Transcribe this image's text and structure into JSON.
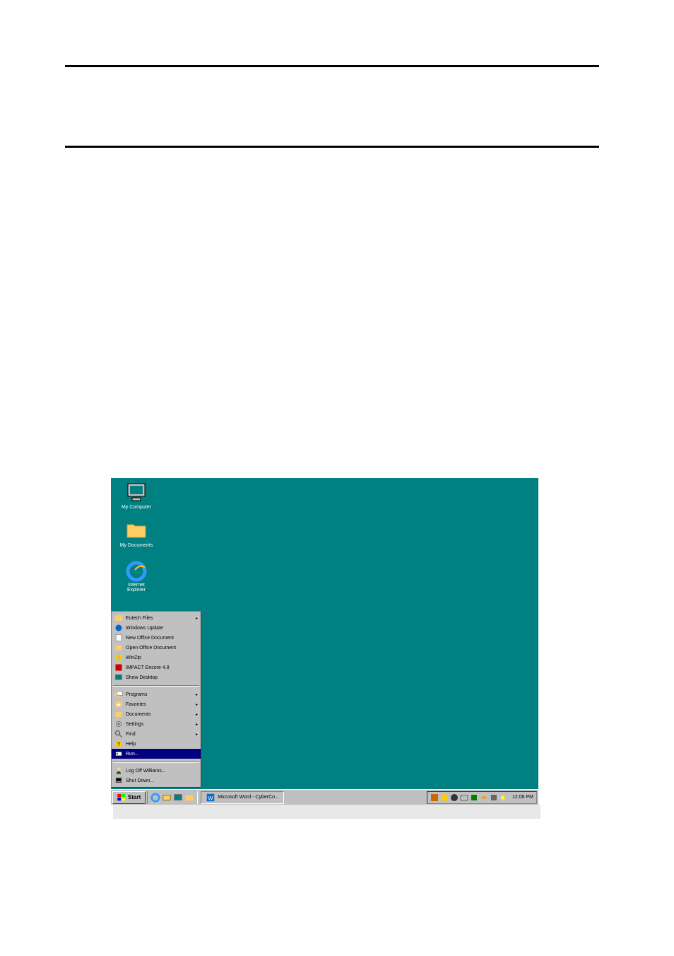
{
  "desktop": {
    "icons": [
      {
        "label": "My Computer"
      },
      {
        "label": "My Documents"
      },
      {
        "label": "Internet Explorer"
      }
    ]
  },
  "start_menu": {
    "top_items": [
      {
        "label": "Eutech Files",
        "has_arrow": true,
        "icon": "folder-icon"
      },
      {
        "label": "Windows Update",
        "has_arrow": false,
        "icon": "update-icon"
      },
      {
        "label": "New Office Document",
        "has_arrow": false,
        "icon": "doc-new-icon"
      },
      {
        "label": "Open Office Document",
        "has_arrow": false,
        "icon": "doc-open-icon"
      },
      {
        "label": "WinZip",
        "has_arrow": false,
        "icon": "winzip-icon"
      },
      {
        "label": "IMPACT Encore 4.8",
        "has_arrow": false,
        "icon": "impact-icon"
      },
      {
        "label": "Show Desktop",
        "has_arrow": false,
        "icon": "desktop-icon"
      }
    ],
    "middle_items": [
      {
        "label": "Programs",
        "has_arrow": true,
        "icon": "programs-icon"
      },
      {
        "label": "Favorites",
        "has_arrow": true,
        "icon": "favorites-icon"
      },
      {
        "label": "Documents",
        "has_arrow": true,
        "icon": "documents-icon"
      },
      {
        "label": "Settings",
        "has_arrow": true,
        "icon": "settings-icon"
      },
      {
        "label": "Find",
        "has_arrow": true,
        "icon": "find-icon"
      },
      {
        "label": "Help",
        "has_arrow": false,
        "icon": "help-icon"
      },
      {
        "label": "Run...",
        "has_arrow": false,
        "icon": "run-icon",
        "highlighted": true
      }
    ],
    "bottom_items": [
      {
        "label": "Log Off Williams...",
        "has_arrow": false,
        "icon": "logoff-icon"
      },
      {
        "label": "Shut Down...",
        "has_arrow": false,
        "icon": "shutdown-icon"
      }
    ]
  },
  "taskbar": {
    "start_label": "Start",
    "task_button": "Microsoft Word - CyberCo...",
    "clock": "12:08 PM"
  },
  "colors": {
    "desktop_bg": "#008080",
    "taskbar_bg": "#c0c0c0",
    "highlight": "#000080"
  }
}
